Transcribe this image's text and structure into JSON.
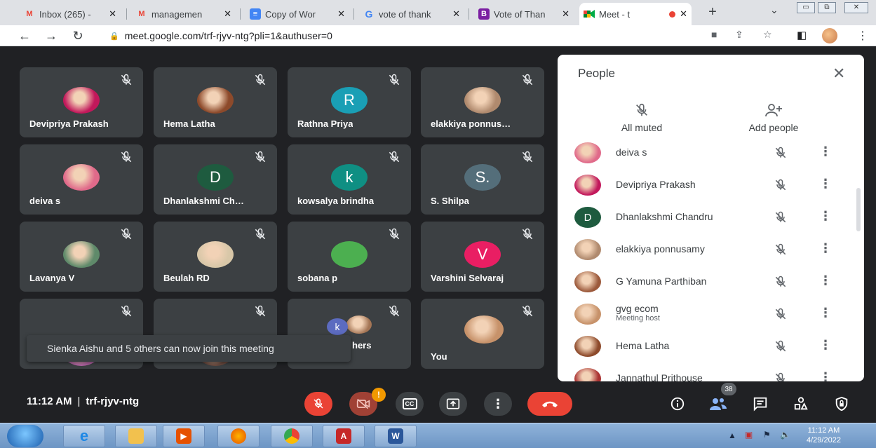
{
  "browser": {
    "tabs": [
      {
        "label": "Inbox (265) - ",
        "icon": "gmail",
        "active": false
      },
      {
        "label": "managemen",
        "icon": "gmail",
        "active": false
      },
      {
        "label": "Copy of Wor",
        "icon": "docs",
        "active": false
      },
      {
        "label": "vote of thank",
        "icon": "google",
        "active": false
      },
      {
        "label": "Vote of Than",
        "icon": "canva",
        "active": false
      },
      {
        "label": "Meet - t",
        "icon": "meet",
        "active": true
      }
    ],
    "url": "meet.google.com/trf-rjyv-ntg?pli=1&authuser=0"
  },
  "tiles": [
    {
      "name": "Devipriya Prakash",
      "kind": "photo",
      "color": "#c2185b"
    },
    {
      "name": "Hema Latha",
      "kind": "photo",
      "color": "#8d4a2b"
    },
    {
      "name": "Rathna Priya",
      "kind": "letter",
      "letter": "R",
      "color": "#1a9fb5"
    },
    {
      "name": "elakkiya ponnus…",
      "kind": "photo",
      "color": "#b08a6e"
    },
    {
      "name": "deiva s",
      "kind": "photo",
      "color": "#e06a8a"
    },
    {
      "name": "Dhanlakshmi Ch…",
      "kind": "letter",
      "letter": "D",
      "color": "#1e5b3f"
    },
    {
      "name": "kowsalya brindha",
      "kind": "letter",
      "letter": "k",
      "color": "#0f8f83"
    },
    {
      "name": "S. Shilpa",
      "kind": "letter",
      "letter": "S.",
      "color": "#546e7a"
    },
    {
      "name": "Lavanya V",
      "kind": "photo",
      "color": "#5f8a6a"
    },
    {
      "name": "Beulah RD",
      "kind": "photo",
      "color": "#d8c7a8"
    },
    {
      "name": "sobana p",
      "kind": "letter",
      "letter": "",
      "color": "#4caf50"
    },
    {
      "name": "Varshini Selvaraj",
      "kind": "letter",
      "letter": "V",
      "color": "#e91e63"
    },
    {
      "name": "",
      "kind": "photo",
      "color": "#b565a7"
    },
    {
      "name": "",
      "kind": "photo",
      "color": "#6d4c41"
    },
    {
      "name": "hers",
      "kind": "group",
      "letter": "k",
      "color": "#5c6bc0"
    },
    {
      "name": "You",
      "kind": "photo",
      "color": "#c7926a"
    }
  ],
  "toast": "Sienka Aishu and 5 others can now join this meeting",
  "people_panel": {
    "title": "People",
    "all_muted_label": "All muted",
    "add_people_label": "Add people",
    "participants": [
      {
        "name": "deiva s",
        "sub": "",
        "kind": "photo",
        "color": "#e06a8a",
        "letter": ""
      },
      {
        "name": "Devipriya Prakash",
        "sub": "",
        "kind": "photo",
        "color": "#c2185b",
        "letter": ""
      },
      {
        "name": "Dhanlakshmi Chandru",
        "sub": "",
        "kind": "letter",
        "color": "#1e5b3f",
        "letter": "D"
      },
      {
        "name": "elakkiya ponnusamy",
        "sub": "",
        "kind": "photo",
        "color": "#b08a6e",
        "letter": ""
      },
      {
        "name": "G Yamuna Parthiban",
        "sub": "",
        "kind": "photo",
        "color": "#9c5a3c",
        "letter": ""
      },
      {
        "name": "gvg ecom",
        "sub": "Meeting host",
        "kind": "photo",
        "color": "#c7926a",
        "letter": ""
      },
      {
        "name": "Hema Latha",
        "sub": "",
        "kind": "photo",
        "color": "#8d4a2b",
        "letter": ""
      },
      {
        "name": "Jannathul Prithouse",
        "sub": "",
        "kind": "photo",
        "color": "#a33",
        "letter": ""
      }
    ]
  },
  "bottom_bar": {
    "time": "11:12 AM",
    "separator": "|",
    "meeting_code": "trf-rjyv-ntg",
    "camera_alert_badge": "!",
    "participants_count": "38"
  },
  "taskbar": {
    "clock_time": "11:12 AM",
    "clock_date": "4/29/2022"
  },
  "colors": {
    "stage_bg": "#202124",
    "tile_bg": "#3c4043",
    "danger": "#ea4335",
    "accent_badge": "#5f6368"
  }
}
